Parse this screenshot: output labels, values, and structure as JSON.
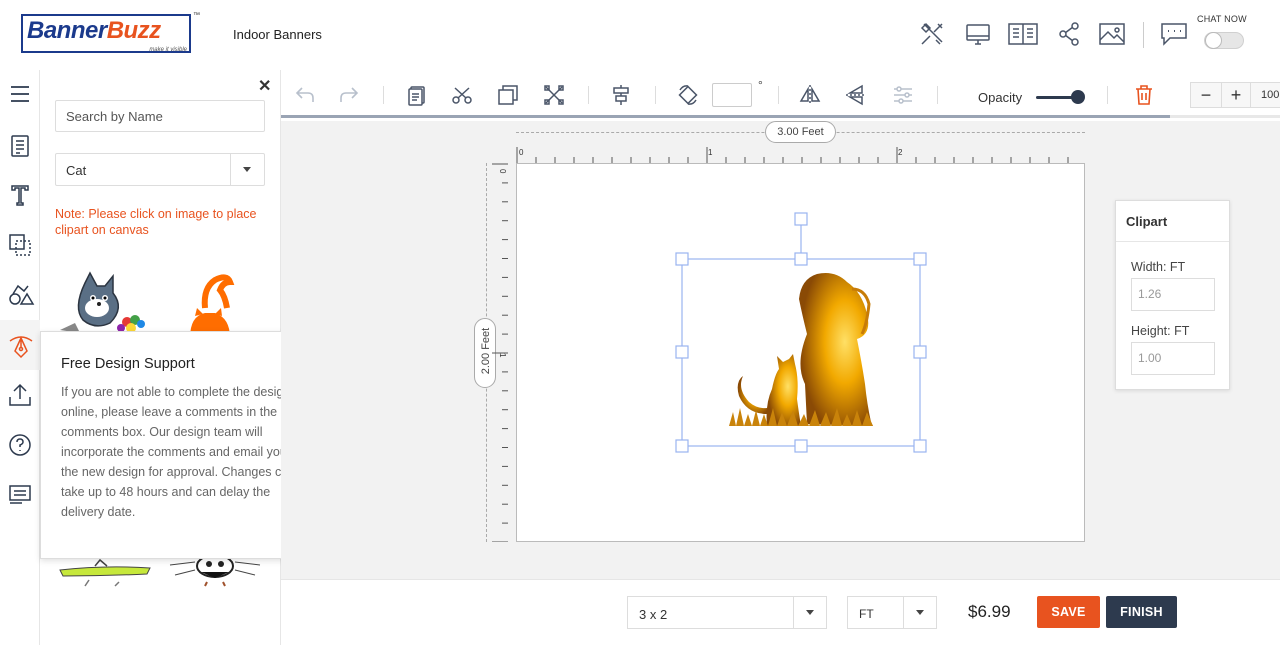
{
  "header": {
    "brand_part1": "Banner",
    "brand_part2": "Buzz",
    "tagline": "make it visible",
    "trademark": "™",
    "product": "Indoor Banners",
    "chat_label": "CHAT NOW",
    "icons": [
      "tools-icon",
      "monitor-icon",
      "book-icon",
      "share-icon",
      "image-icon",
      "chat-icon"
    ]
  },
  "left_rail": {
    "icons": [
      "menu-icon",
      "template-icon",
      "text-icon",
      "shapes-icon",
      "clipart-icon",
      "pen-icon",
      "upload-icon",
      "help-icon",
      "comments-icon"
    ],
    "active": "pen-icon"
  },
  "panel": {
    "search_placeholder": "Search by Name",
    "category": "Cat",
    "note": "Note: Please click on image to place clipart on canvas"
  },
  "tooltip": {
    "title": "Free Design Support",
    "body": "If you are not able to complete the design online, please leave a comments in the comments box. Our design team will incorporate the comments and email you the new design for approval. Changes can take up to 48 hours and can delay the delivery date."
  },
  "toolbar": {
    "opacity_label": "Opacity",
    "opacity_value": 1.0,
    "rotation_value": "",
    "degree_symbol": "°",
    "zoom_minus": "−",
    "zoom_plus": "+",
    "zoom_value": "100",
    "progress": 0.89
  },
  "canvas": {
    "width_label": "3.00 Feet",
    "height_label": "2.00 Feet",
    "ruler_top": [
      "0",
      "1",
      "2"
    ],
    "ruler_left": [
      "0",
      "1"
    ]
  },
  "props": {
    "title": "Clipart",
    "width_label": "Width: FT",
    "width_value": "1.26",
    "height_label": "Height: FT",
    "height_value": "1.00"
  },
  "footer": {
    "size": "3 x 2",
    "unit": "FT",
    "price": "$6.99",
    "save": "SAVE",
    "finish": "FINISH"
  },
  "colors": {
    "brand_blue": "#1b3a8c",
    "accent_orange": "#e8531f",
    "dark_navy": "#2d3a4e"
  }
}
